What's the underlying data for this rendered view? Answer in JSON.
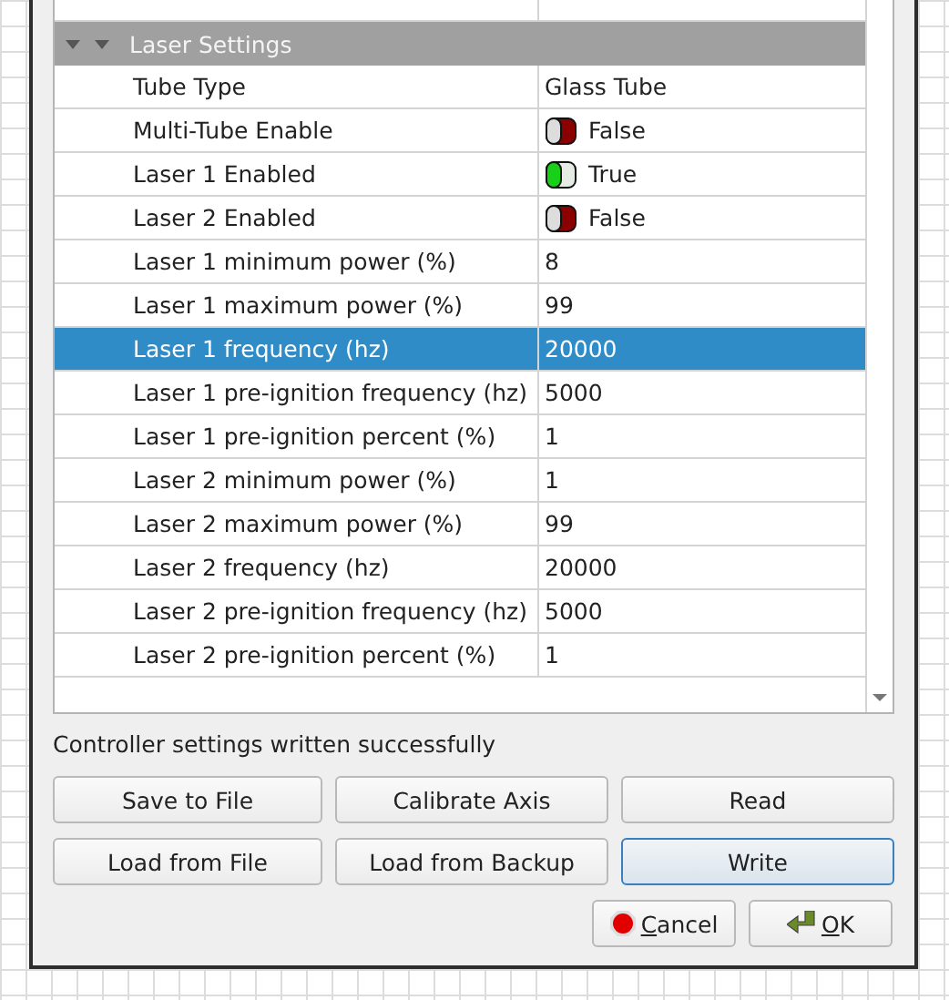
{
  "groups": [
    {
      "label": "Laser Settings",
      "expanded": true,
      "rows": [
        {
          "name": "Tube Type",
          "kind": "text",
          "value": "Glass Tube",
          "selected": false
        },
        {
          "name": "Multi-Tube Enable",
          "kind": "toggle",
          "on": false,
          "value": "False",
          "selected": false
        },
        {
          "name": "Laser 1 Enabled",
          "kind": "toggle",
          "on": true,
          "value": "True",
          "selected": false
        },
        {
          "name": "Laser 2 Enabled",
          "kind": "toggle",
          "on": false,
          "value": "False",
          "selected": false
        },
        {
          "name": "Laser 1 minimum power (%)",
          "kind": "text",
          "value": "8",
          "selected": false
        },
        {
          "name": "Laser 1 maximum power (%)",
          "kind": "text",
          "value": "99",
          "selected": false
        },
        {
          "name": "Laser 1 frequency (hz)",
          "kind": "text",
          "value": "20000",
          "selected": true
        },
        {
          "name": "Laser 1 pre-ignition frequency (hz)",
          "kind": "text",
          "value": "5000",
          "selected": false
        },
        {
          "name": "Laser 1 pre-ignition percent (%)",
          "kind": "text",
          "value": "1",
          "selected": false
        },
        {
          "name": "Laser 2 minimum power (%)",
          "kind": "text",
          "value": "1",
          "selected": false
        },
        {
          "name": "Laser 2 maximum power (%)",
          "kind": "text",
          "value": "99",
          "selected": false
        },
        {
          "name": "Laser 2 frequency (hz)",
          "kind": "text",
          "value": "20000",
          "selected": false
        },
        {
          "name": "Laser 2 pre-ignition frequency (hz)",
          "kind": "text",
          "value": "5000",
          "selected": false
        },
        {
          "name": "Laser 2 pre-ignition percent (%)",
          "kind": "text",
          "value": "1",
          "selected": false
        }
      ]
    }
  ],
  "status": "Controller settings written successfully",
  "buttons": [
    {
      "label": "Save to File",
      "default": false
    },
    {
      "label": "Calibrate Axis",
      "default": false
    },
    {
      "label": "Read",
      "default": false
    },
    {
      "label": "Load from File",
      "default": false
    },
    {
      "label": "Load from Backup",
      "default": false
    },
    {
      "label": "Write",
      "default": true
    }
  ],
  "dialog_buttons": [
    {
      "label": "Cancel",
      "kind": "cancel",
      "mnemonic_underlined": true
    },
    {
      "label": "OK",
      "kind": "ok",
      "mnemonic_underlined": true
    }
  ]
}
